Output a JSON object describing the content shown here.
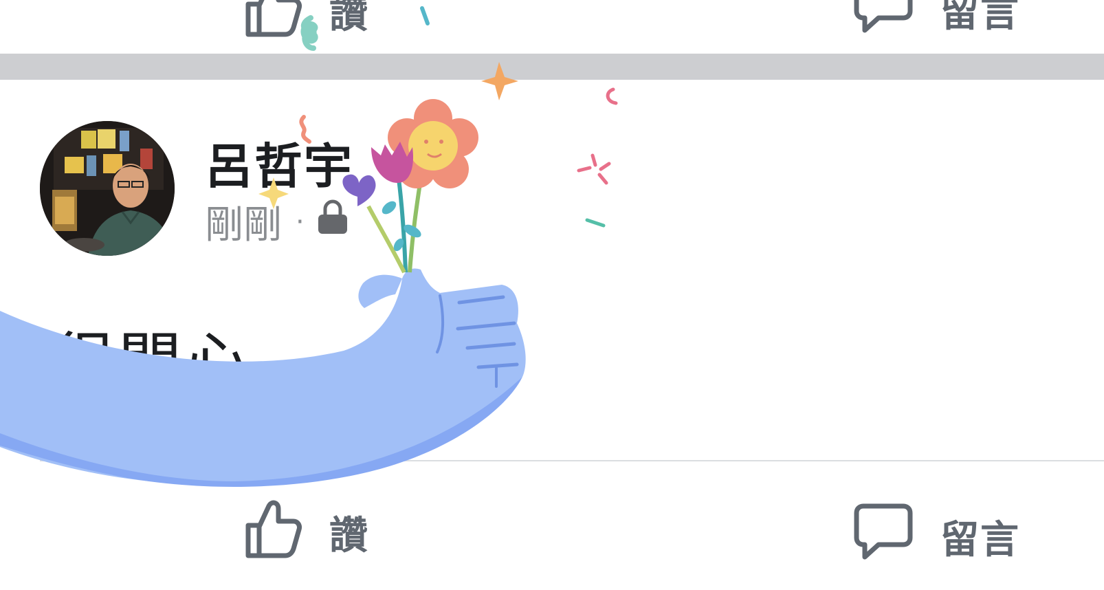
{
  "top_actions": {
    "like_label": "讚",
    "comment_label": "留言"
  },
  "post": {
    "author": "呂哲宇",
    "timestamp": "剛剛",
    "separator": "·",
    "privacy_icon": "lock-icon",
    "text": "很開心"
  },
  "bottom_actions": {
    "like_label": "讚",
    "comment_label": "留言"
  },
  "colors": {
    "separator_band": "#cdced1",
    "action_text": "#606770",
    "meta_text": "#8a8d91",
    "hand_blue": "#a1bff7",
    "hand_shadow": "#86a8f3"
  }
}
